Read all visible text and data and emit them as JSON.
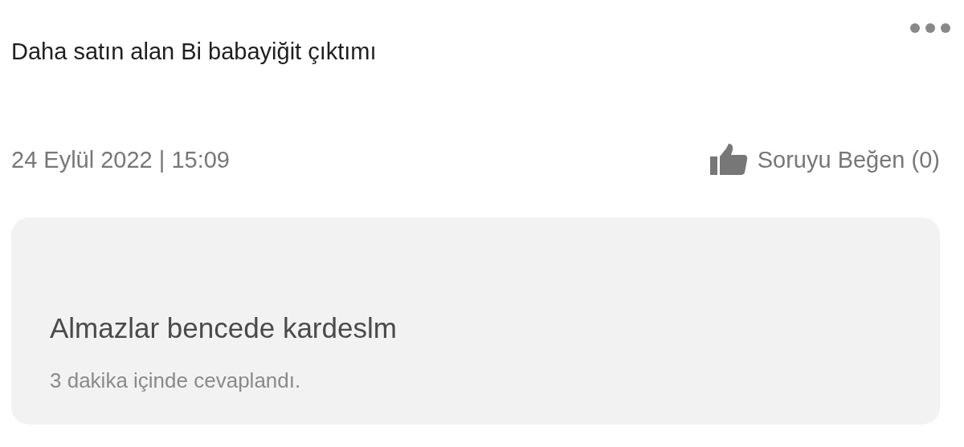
{
  "question": {
    "text": "Daha satın alan Bi babayiğit çıktımı",
    "date": "24 Eylül 2022 | 15:09",
    "like_label": "Soruyu Beğen (0)"
  },
  "answer": {
    "text": "Almazlar bencede kardeslm",
    "note": "3 dakika içinde cevaplandı."
  }
}
